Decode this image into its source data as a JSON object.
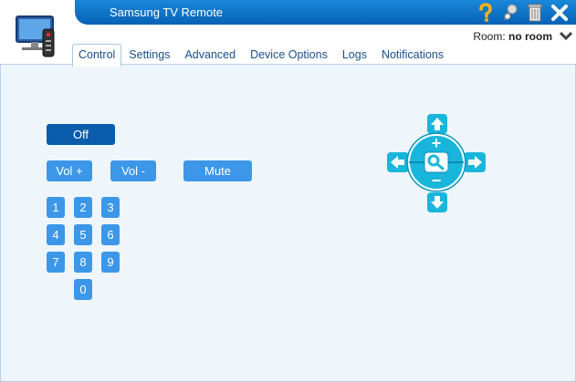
{
  "window": {
    "title": "Samsung TV Remote"
  },
  "header": {
    "room_label": "Room:",
    "room_value": "no room",
    "icons": [
      "help-icon",
      "pin-icon",
      "trash-icon",
      "close-icon",
      "chevron-down-icon"
    ]
  },
  "tabs": [
    {
      "label": "Control",
      "active": true
    },
    {
      "label": "Settings"
    },
    {
      "label": "Advanced"
    },
    {
      "label": "Device Options"
    },
    {
      "label": "Logs"
    },
    {
      "label": "Notifications"
    }
  ],
  "controls": {
    "off": "Off",
    "vol_up": "Vol +",
    "vol_down": "Vol -",
    "mute": "Mute"
  },
  "keypad": [
    "1",
    "2",
    "3",
    "4",
    "5",
    "6",
    "7",
    "8",
    "9",
    "0"
  ],
  "dpad": {
    "plus": "+",
    "minus": "−",
    "icons": [
      "arrow-up-icon",
      "arrow-down-icon",
      "arrow-left-icon",
      "arrow-right-icon",
      "magnifier-icon"
    ]
  },
  "colors": {
    "title_bar": "#0661b4",
    "button_dark": "#0b5cab",
    "button": "#3d97e8",
    "dpad": "#19b6dc"
  }
}
